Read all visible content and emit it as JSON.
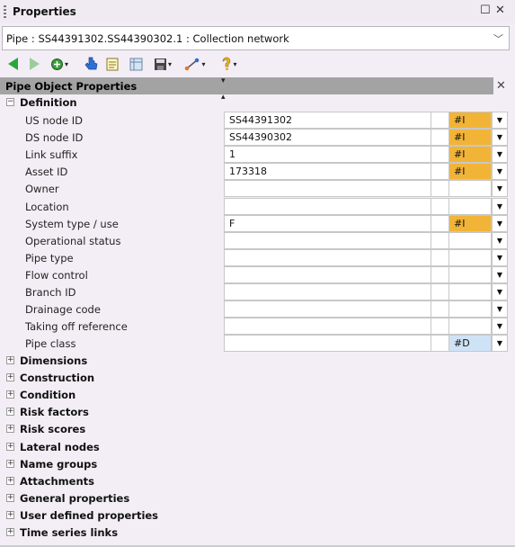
{
  "window": {
    "title": "Properties",
    "pin_glyph": "☐",
    "close_glyph": "✕"
  },
  "selector": {
    "value": "Pipe : SS44391302.SS44390302.1 : Collection network",
    "chevron": "﹀"
  },
  "toolbar": {
    "icons": [
      "back-icon",
      "forward-icon",
      "navigate-icon",
      "select-icon",
      "report-icon",
      "grid-icon",
      "save-icon",
      "network-link-icon",
      "help-icon"
    ]
  },
  "panel": {
    "header": "Pipe Object Properties",
    "close_glyph": "✕"
  },
  "definition": {
    "label": "Definition",
    "expander": "⊟",
    "rows": [
      {
        "label": "US node ID",
        "value": "SS44391302",
        "flag": "#I"
      },
      {
        "label": "DS node ID",
        "value": "SS44390302",
        "flag": "#I"
      },
      {
        "label": "Link suffix",
        "value": "1",
        "flag": "#I"
      },
      {
        "label": "Asset ID",
        "value": "173318",
        "flag": "#I"
      },
      {
        "label": "Owner",
        "value": "",
        "flag": ""
      },
      {
        "label": "Location",
        "value": "",
        "flag": ""
      },
      {
        "label": "System type / use",
        "value": "F",
        "flag": "#I"
      },
      {
        "label": "Operational status",
        "value": "",
        "flag": ""
      },
      {
        "label": "Pipe type",
        "value": "",
        "flag": ""
      },
      {
        "label": "Flow control",
        "value": "",
        "flag": ""
      },
      {
        "label": "Branch ID",
        "value": "",
        "flag": ""
      },
      {
        "label": "Drainage code",
        "value": "",
        "flag": ""
      },
      {
        "label": "Taking off reference",
        "value": "",
        "flag": ""
      },
      {
        "label": "Pipe class",
        "value": "",
        "flag": "#D"
      }
    ]
  },
  "groups": [
    "Dimensions",
    "Construction",
    "Condition",
    "Risk factors",
    "Risk scores",
    "Lateral nodes",
    "Name groups",
    "Attachments",
    "General properties",
    "User defined properties",
    "Time series links"
  ],
  "colors": {
    "flag_I": "#f2b437",
    "flag_D": "#cfe3f7",
    "header": "#a3a3a3"
  }
}
